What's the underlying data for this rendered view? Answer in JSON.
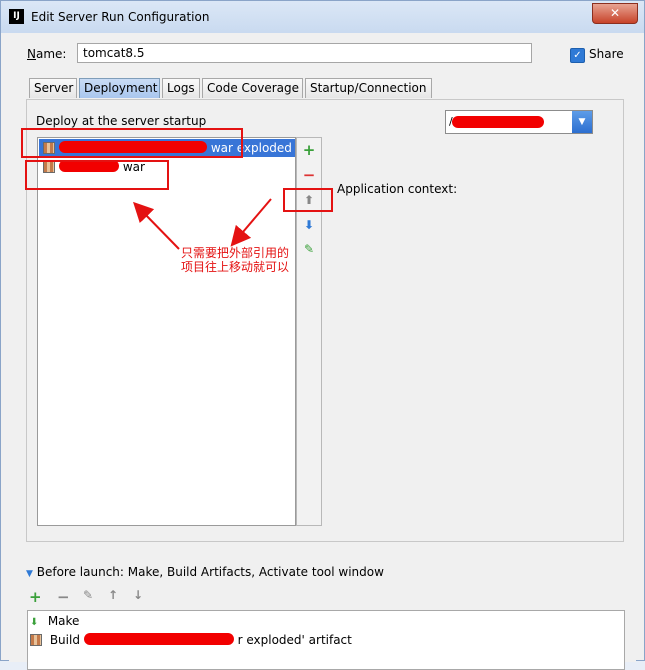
{
  "window": {
    "title": "Edit Server Run Configuration",
    "close_symbol": "✕",
    "app_icon_text": "IJ"
  },
  "name_label": "Name:",
  "name_value": "tomcat8.5",
  "share": {
    "label": "Share",
    "checked": true,
    "check_symbol": "✓"
  },
  "tabs": [
    {
      "label": "Server",
      "active": false
    },
    {
      "label": "Deployment",
      "active": true
    },
    {
      "label": "Logs",
      "active": false
    },
    {
      "label": "Code Coverage",
      "active": false
    },
    {
      "label": "Startup/Connection",
      "active": false
    }
  ],
  "deploy": {
    "heading": "Deploy at the server startup",
    "items": [
      {
        "suffix": "war exploded",
        "selected": true
      },
      {
        "suffix": "war",
        "selected": false
      }
    ],
    "tool_symbols": [
      "+",
      "−",
      "⬆",
      "⬇",
      "✎"
    ],
    "app_context_label": "Application context:",
    "app_context_value": "/",
    "combo_arrow": "▼"
  },
  "annotation": {
    "line1": "只需要把外部引用的",
    "line2": "项目往上移动就可以"
  },
  "before_launch": {
    "heading": "Before launch: Make, Build Artifacts, Activate tool window",
    "toolbar_symbols": [
      "+",
      "−",
      "✎",
      "↑",
      "↓"
    ],
    "items": [
      {
        "label": "Make"
      },
      {
        "prefix": "Build",
        "suffix": "r exploded' artifact"
      }
    ]
  },
  "colors": {
    "accent": "#3875d7",
    "annotation_red": "#e41212",
    "redaction": "#f20000"
  }
}
